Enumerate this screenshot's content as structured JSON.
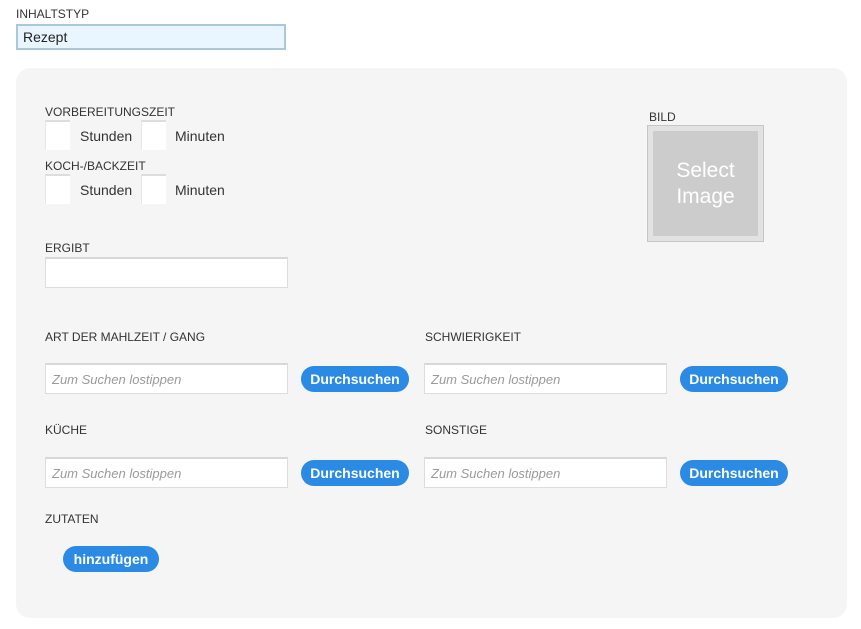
{
  "content_type": {
    "label": "INHALTSTYP",
    "value": "Rezept"
  },
  "prep_time": {
    "label": "VORBEREITUNGSZEIT",
    "hours_unit": "Stunden",
    "minutes_unit": "Minuten"
  },
  "cook_time": {
    "label": "KOCH-/BACKZEIT",
    "hours_unit": "Stunden",
    "minutes_unit": "Minuten"
  },
  "image": {
    "label": "BILD",
    "line1": "Select",
    "line2": "Image"
  },
  "yield": {
    "label": "ERGIBT"
  },
  "meal_type": {
    "label": "ART DER MAHLZEIT / GANG",
    "placeholder": "Zum Suchen lostippen",
    "button": "Durchsuchen"
  },
  "difficulty": {
    "label": "SCHWIERIGKEIT",
    "placeholder": "Zum Suchen lostippen",
    "button": "Durchsuchen"
  },
  "cuisine": {
    "label": "KÜCHE",
    "placeholder": "Zum Suchen lostippen",
    "button": "Durchsuchen"
  },
  "misc": {
    "label": "SONSTIGE",
    "placeholder": "Zum Suchen lostippen",
    "button": "Durchsuchen"
  },
  "ingredients": {
    "label": "ZUTATEN",
    "add_button": "hinzufügen"
  },
  "colors": {
    "accent": "#2a8ae4",
    "panel": "#f5f5f5",
    "select_bg": "#eaf6ff"
  }
}
